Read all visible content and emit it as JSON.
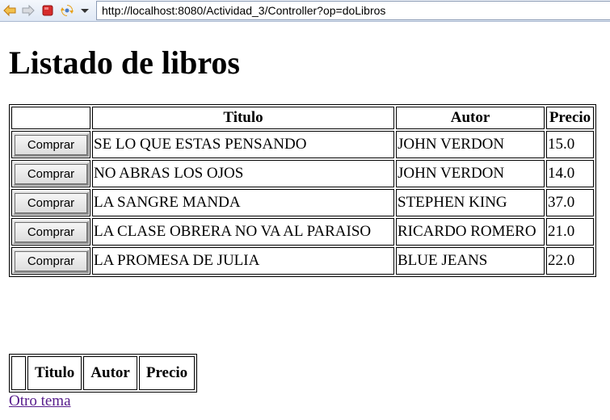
{
  "browser": {
    "url": "http://localhost:8080/Actividad_3/Controller?op=doLibros",
    "icons": [
      "back-arrow-icon",
      "forward-arrow-icon",
      "stop-icon",
      "refresh-icon",
      "dropdown-arrow-icon"
    ],
    "colors": {
      "back": "#e8a21c",
      "forward": "#b9bcc2",
      "stop": "#d62b2b",
      "refresh": "#e8a21c"
    }
  },
  "page": {
    "title": "Listado de libros"
  },
  "books_table": {
    "headers": [
      "",
      "Titulo",
      "Autor",
      "Precio"
    ],
    "button_label": "Comprar",
    "rows": [
      {
        "titulo": "SE LO QUE ESTAS PENSANDO",
        "autor": "JOHN VERDON",
        "precio": "15.0"
      },
      {
        "titulo": "NO ABRAS LOS OJOS",
        "autor": "JOHN VERDON",
        "precio": "14.0"
      },
      {
        "titulo": "LA SANGRE MANDA",
        "autor": "STEPHEN KING",
        "precio": "37.0"
      },
      {
        "titulo": "LA CLASE OBRERA NO VA AL PARAISO",
        "autor": "RICARDO ROMERO",
        "precio": "21.0"
      },
      {
        "titulo": "LA PROMESA DE JULIA",
        "autor": "BLUE JEANS",
        "precio": "22.0"
      }
    ]
  },
  "cart_table": {
    "headers": [
      "",
      "Titulo",
      "Autor",
      "Precio"
    ]
  },
  "link": {
    "label": "Otro tema",
    "color": "#551a8b"
  }
}
